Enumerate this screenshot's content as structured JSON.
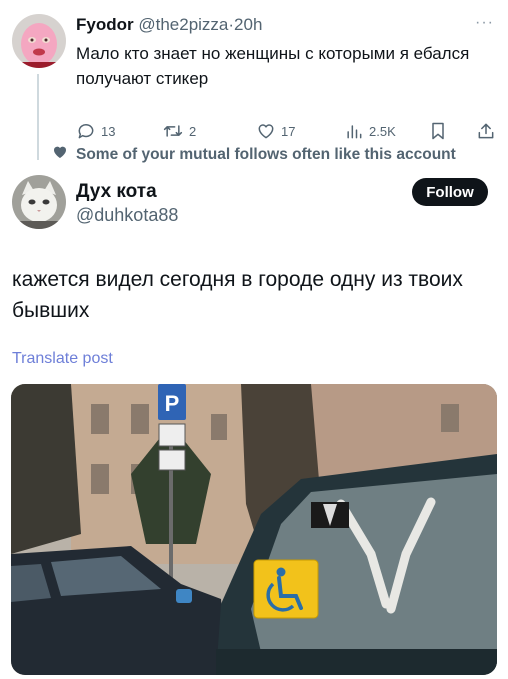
{
  "reply": {
    "author_name": "Fyodor",
    "author_handle": "@the2pizza",
    "separator": "·",
    "time": "20h",
    "text": "Мало кто знает но женщины с которыми я ебался получают стикер",
    "more_icon": "ellipsis-icon",
    "actions": {
      "replies": "13",
      "reposts": "2",
      "likes": "17",
      "views": "2.5K"
    },
    "icons": [
      "reply-icon",
      "repost-icon",
      "like-icon",
      "views-icon",
      "bookmark-icon",
      "share-icon"
    ]
  },
  "social_context": {
    "text": "Some of your mutual follows often like this account",
    "icon": "heart-icon"
  },
  "post": {
    "author_name": "Дух кота",
    "author_handle": "@duhkota88",
    "follow_label": "Follow",
    "text": "кажется видел сегодня в городе одну из твоих бывших",
    "translate_label": "Translate post"
  },
  "colors": {
    "text": "#0f1419",
    "muted": "#536471",
    "translate": "#6e7fd8",
    "follow_bg": "#0f1419",
    "thread_line": "#cfd9de",
    "disabled_sign": "#f2c21b"
  }
}
